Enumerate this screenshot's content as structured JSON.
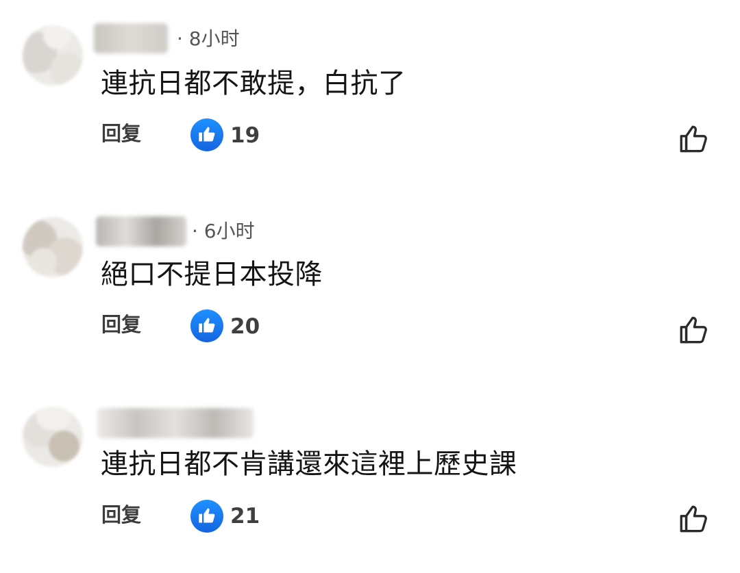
{
  "comments": [
    {
      "time": "· 8小时",
      "text": "連抗日都不敢提，白抗了",
      "reply_label": "回复",
      "like_count": "19"
    },
    {
      "time": "· 6小时",
      "text": "絕口不提日本投降",
      "reply_label": "回复",
      "like_count": "20"
    },
    {
      "time": "",
      "text": "連抗日都不肯講還來這裡上歷史課",
      "reply_label": "回复",
      "like_count": "21"
    }
  ],
  "colors": {
    "like_badge": "#1a73e8",
    "text": "#141414",
    "meta": "#555555"
  },
  "icons": {
    "like_badge": "thumbs-up-icon",
    "like_button": "thumbs-up-outline-icon"
  }
}
